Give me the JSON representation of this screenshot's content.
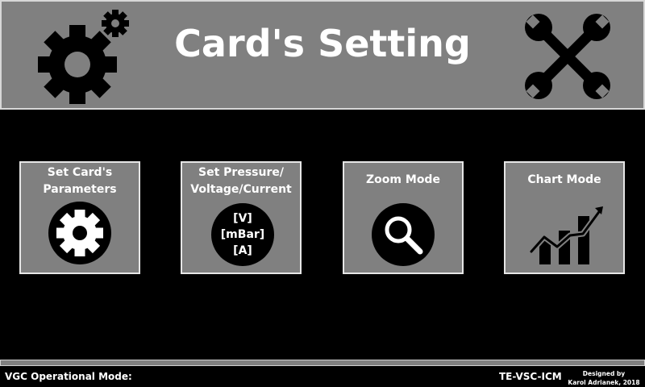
{
  "header": {
    "title": "Card's Setting",
    "left_icon": "gears-icon",
    "right_icon": "crossed-wrenches-icon"
  },
  "cards": [
    {
      "label_line1": "Set Card's",
      "label_line2": "Parameters",
      "icon": "gear-icon"
    },
    {
      "label_line1": "Set Pressure/",
      "label_line2": "Voltage/Current",
      "icon": "units-icon",
      "units": [
        "[V]",
        "[mBar]",
        "[A]"
      ]
    },
    {
      "label_line1": "Zoom Mode",
      "icon": "magnifier-icon"
    },
    {
      "label_line1": "Chart Mode",
      "icon": "bar-chart-icon"
    }
  ],
  "footer": {
    "operational_mode_label": "VGC Operational Mode:",
    "system_name": "TE-VSC-ICM",
    "credit_line1": "Designed by",
    "credit_line2": "Karol Adrianek, 2018"
  },
  "colors": {
    "background": "#000000",
    "panel": "#808080",
    "border": "#e6e6e6",
    "text": "#ffffff"
  }
}
